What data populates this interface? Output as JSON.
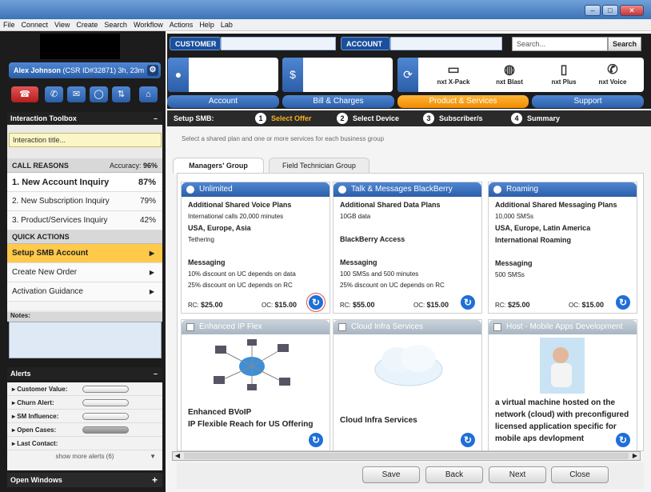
{
  "window": {
    "min": "–",
    "max": "□",
    "close": "✕"
  },
  "menu": [
    "File",
    "Connect",
    "View",
    "Create",
    "Search",
    "Workflow",
    "Actions",
    "Help",
    "Lab"
  ],
  "user": {
    "name": "Alex Johnson",
    "detail": "(CSR ID#32871) 3h, 23m"
  },
  "quick_icons": [
    "end-call-icon",
    "phone-icon",
    "mail-icon",
    "chat-icon",
    "transfer-icon",
    "home-icon"
  ],
  "toolbox": {
    "title": "Interaction Toolbox",
    "min": "–",
    "title_placeholder": "Interaction title..."
  },
  "call_reasons": {
    "header": "CALL REASONS",
    "accuracy_label": "Accuracy:",
    "accuracy": "96%",
    "items": [
      {
        "label": "1. New Account Inquiry",
        "pct": "87%"
      },
      {
        "label": "2. New Subscription Inquiry",
        "pct": "79%"
      },
      {
        "label": "3. Product/Services Inquiry",
        "pct": "42%"
      }
    ]
  },
  "quick_actions": {
    "header": "QUICK ACTIONS",
    "items": [
      "Setup SMB Account",
      "Create New Order",
      "Activation Guidance"
    ]
  },
  "notes_label": "Notes:",
  "alerts": {
    "title": "Alerts",
    "min": "–",
    "items": [
      "Customer Value:",
      "Churn Alert:",
      "SM Influence:",
      "Open Cases:",
      "Last Contact:"
    ],
    "show_more": "show more alerts (6)"
  },
  "open_windows": {
    "title": "Open Windows",
    "plus": "+"
  },
  "top": {
    "customer": "CUSTOMER",
    "account": "ACCOUNT",
    "search_placeholder": "Search...",
    "search_btn": "Search"
  },
  "products": [
    {
      "name": "nxt X-Pack",
      "icon": "▭"
    },
    {
      "name": "nxt Blast",
      "icon": "◍"
    },
    {
      "name": "nxt Plus",
      "icon": "▯"
    },
    {
      "name": "nxt Voice",
      "icon": "✆"
    }
  ],
  "main_tabs": [
    "Account",
    "Bill & Charges",
    "Product & Services",
    "Support"
  ],
  "steps": {
    "label": "Setup SMB:",
    "items": [
      {
        "num": "1",
        "label": "Select Offer"
      },
      {
        "num": "2",
        "label": "Select Device"
      },
      {
        "num": "3",
        "label": "Subscriber/s"
      },
      {
        "num": "4",
        "label": "Summary"
      }
    ]
  },
  "instruction": "Select a shared plan and one or more services for each business group",
  "sub_tabs": [
    "Managers' Group",
    "Field Technician Group"
  ],
  "plans": [
    {
      "title": "Unlimited",
      "sec1": "Additional Shared Voice Plans",
      "l1": "International calls 20,000 minutes",
      "sec2": "USA, Europe, Asia",
      "l2": "Tethering",
      "sec3": "Messaging",
      "l3": "10% discount on UC depends on data",
      "l4": "25% discount on UC depends on RC",
      "rc_label": "RC:",
      "rc": "$25.00",
      "oc_label": "OC:",
      "oc": "$15.00"
    },
    {
      "title": "Talk & Messages BlackBerry",
      "sec1": "Additional Shared Data Plans",
      "l1": "10GB data",
      "sec2": "BlackBerry Access",
      "l2": "",
      "sec3": "Messaging",
      "l3": "100 SMSs and 500 minutes",
      "l4": "25% discount on UC depends on RC",
      "rc_label": "RC:",
      "rc": "$55.00",
      "oc_label": "OC:",
      "oc": "$15.00"
    },
    {
      "title": "Roaming",
      "sec1": "Additional Shared Messaging Plans",
      "l1": "10,000 SMSs",
      "sec2": "USA, Europe, Latin America",
      "l2": "International Roaming",
      "sec3": "Messaging",
      "l3": "500 SMSs",
      "l4": "",
      "rc_label": "RC:",
      "rc": "$25.00",
      "oc_label": "OC:",
      "oc": "$15.00"
    }
  ],
  "services": [
    {
      "title": "Enhanced IP Flex",
      "text1": "Enhanced BVoIP",
      "text2": "IP Flexible Reach for US Offering"
    },
    {
      "title": "Cloud Infra Services",
      "text1": "Cloud Infra Services"
    },
    {
      "title": "Host - Mobile Apps Development",
      "text1": "a virtual machine hosted on the network (cloud) with preconfigured licensed application specific for mobile aps devlopment"
    }
  ],
  "buttons": {
    "save": "Save",
    "back": "Back",
    "next": "Next",
    "close": "Close"
  }
}
